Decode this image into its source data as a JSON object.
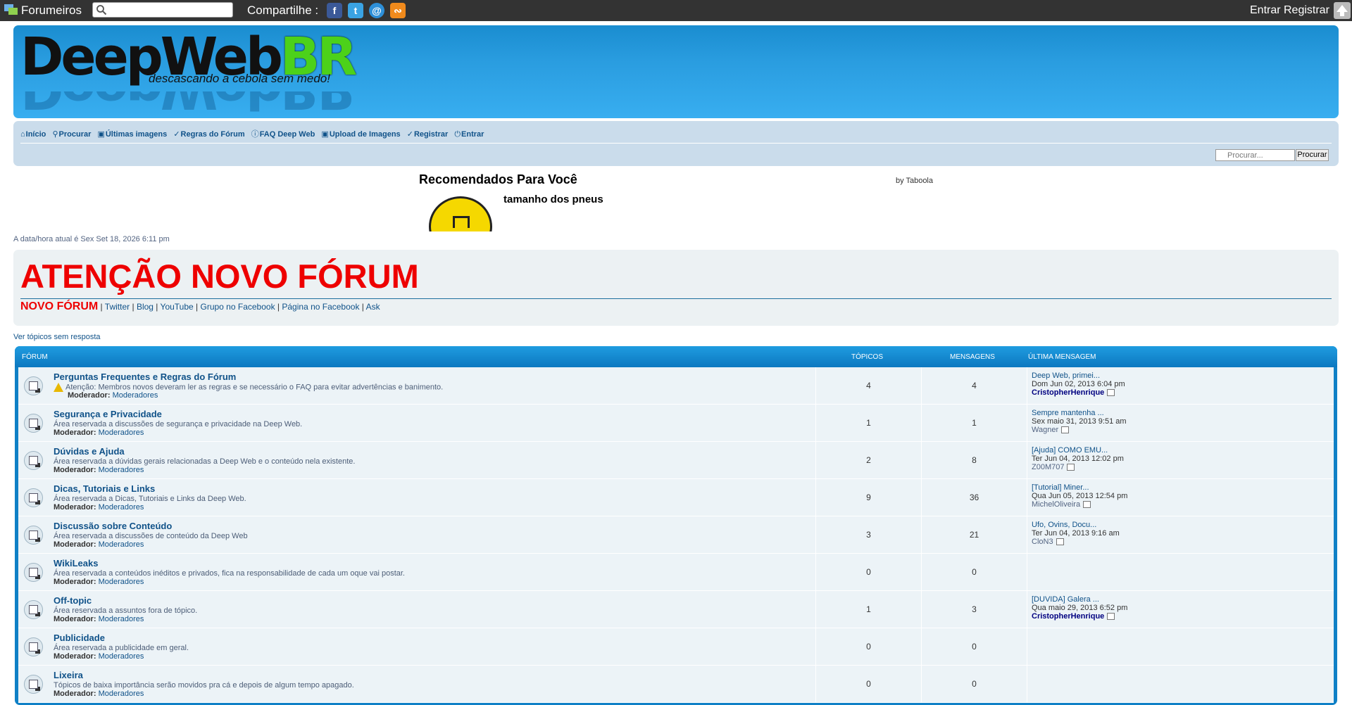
{
  "topbar": {
    "brand": "Forumeiros",
    "search_placeholder": "",
    "share_label": "Compartilhe :",
    "login": "Entrar",
    "register": "Registrar"
  },
  "banner": {
    "logo_main": "DeepWeb",
    "logo_accent": "BR",
    "tagline": "descascando a cebola sem medo!"
  },
  "nav": {
    "items": [
      "Início",
      "Procurar",
      "Últimas imagens",
      "Regras do Fórum",
      "FAQ Deep Web",
      "Upload de Imagens",
      "Registrar",
      "Entrar"
    ],
    "search_placeholder": "Procurar...",
    "search_button": "Procurar"
  },
  "recs": {
    "title": "Recomendados Para Você",
    "by": "by Taboola",
    "item": "tamanho dos pneus"
  },
  "datetime": "A data/hora atual é Sex Set 18, 2026 6:11 pm",
  "notice": {
    "title": "ATENÇÃO NOVO FÓRUM",
    "novo": "NOVO FÓRUM",
    "links": [
      "Twitter",
      "Blog",
      "YouTube",
      "Grupo no Facebook",
      "Página no Facebook",
      "Ask"
    ]
  },
  "unanswered": "Ver tópicos sem resposta",
  "table": {
    "col_forum": "Fórum",
    "col_topics": "Tópicos",
    "col_posts": "Mensagens",
    "col_last": "Última mensagem",
    "mod_label": "Moderador:",
    "mod_link": "Moderadores",
    "rows": [
      {
        "name": "Perguntas Frequentes e Regras do Fórum",
        "desc": "Atenção: Membros novos deveram ler as regras e se necessário o FAQ para evitar advertências e banimento.",
        "topics": "4",
        "posts": "4",
        "last_title": "Deep Web, primei...",
        "last_date": "Dom Jun 02, 2013 6:04 pm",
        "last_author": "CristopherHenrique"
      },
      {
        "name": "Segurança e Privacidade",
        "desc": "Área reservada a discussões de segurança e privacidade na Deep Web.",
        "topics": "1",
        "posts": "1",
        "last_title": "Sempre mantenha ...",
        "last_date": "Sex maio 31, 2013 9:51 am",
        "last_author": "Wagner"
      },
      {
        "name": "Dúvidas e Ajuda",
        "desc": "Área reservada a dúvidas gerais relacionadas a Deep Web e o conteúdo nela existente.",
        "topics": "2",
        "posts": "8",
        "last_title": "[Ajuda] COMO EMU...",
        "last_date": "Ter Jun 04, 2013 12:02 pm",
        "last_author": "Z00M707"
      },
      {
        "name": "Dicas, Tutoriais e Links",
        "desc": "Área reservada a Dicas, Tutoriais e Links da Deep Web.",
        "topics": "9",
        "posts": "36",
        "last_title": "[Tutorial] Miner...",
        "last_date": "Qua Jun 05, 2013 12:54 pm",
        "last_author": "MichelOliveira"
      },
      {
        "name": "Discussão sobre Conteúdo",
        "desc": "Área reservada a discussões de conteúdo da Deep Web",
        "topics": "3",
        "posts": "21",
        "last_title": "Ufo, Ovins, Docu...",
        "last_date": "Ter Jun 04, 2013 9:16 am",
        "last_author": "CloN3"
      },
      {
        "name": "WikiLeaks",
        "desc": "Área reservada a conteúdos inéditos e privados, fica na responsabilidade de cada um oque vai postar.",
        "topics": "0",
        "posts": "0",
        "last_title": "",
        "last_date": "",
        "last_author": ""
      },
      {
        "name": "Off-topic",
        "desc": "Área reservada a assuntos fora de tópico.",
        "topics": "1",
        "posts": "3",
        "last_title": "[DUVIDA] Galera ...",
        "last_date": "Qua maio 29, 2013 6:52 pm",
        "last_author": "CristopherHenrique"
      },
      {
        "name": "Publicidade",
        "desc": "Área reservada a publicidade em geral.",
        "topics": "0",
        "posts": "0",
        "last_title": "",
        "last_date": "",
        "last_author": ""
      },
      {
        "name": "Lixeira",
        "desc": "Tópicos de baixa importância serão movidos pra cá e depois de algum tempo apagado.",
        "topics": "0",
        "posts": "0",
        "last_title": "",
        "last_date": "",
        "last_author": ""
      }
    ]
  }
}
